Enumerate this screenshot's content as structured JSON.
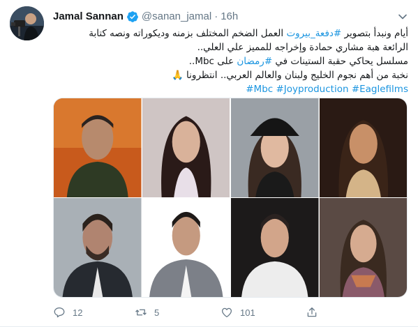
{
  "tweet": {
    "author_name": "Jamal Sannan",
    "verified": true,
    "handle": "@sanan_jamal",
    "separator": "·",
    "time": "16h",
    "lines": [
      {
        "parts": [
          {
            "t": "أيام ونبدأ بتصوير ",
            "link": false
          },
          {
            "t": "#دفعة_بيروت",
            "link": true
          },
          {
            "t": " العمل الضخم المختلف بزمنه وديكوراته ونصه كتابة",
            "link": false
          }
        ]
      },
      {
        "parts": [
          {
            "t": "الرائعة هبة مشاري حمادة وإخراجه للمميز علي العلي..",
            "link": false
          }
        ]
      },
      {
        "parts": [
          {
            "t": "مسلسل يحاكي حقبة الستينات في ",
            "link": false
          },
          {
            "t": "#رمضان",
            "link": true
          },
          {
            "t": " على Mbc..",
            "link": false
          }
        ]
      },
      {
        "parts": [
          {
            "t": "نخبة من أهم نجوم الخليج ولبنان والعالم العربي.. انتظرونا ",
            "link": false
          },
          {
            "t": "🙏",
            "link": false,
            "emoji": true
          }
        ]
      }
    ],
    "hashtags": "#Mbc #Joyproduction #Eaglefilms",
    "reply_count": "12",
    "retweet_count": "5",
    "like_count": "101"
  },
  "colors": {
    "link": "#1b95e0",
    "muted": "#657786",
    "verified": "#1da1f2"
  },
  "icons": {
    "verified": "verified-badge-icon",
    "caret": "chevron-down-icon",
    "reply": "reply-icon",
    "retweet": "retweet-icon",
    "like": "heart-icon",
    "share": "share-icon"
  },
  "media": {
    "photo_count": 8,
    "photos": [
      {
        "name": "portrait-man-dark-shirt"
      },
      {
        "name": "portrait-woman-long-dark-hair"
      },
      {
        "name": "portrait-man-beard-suit"
      },
      {
        "name": "portrait-man-grey-suit"
      },
      {
        "name": "portrait-woman-black-cap"
      },
      {
        "name": "portrait-woman-smiling"
      },
      {
        "name": "portrait-man-white-shirt"
      },
      {
        "name": "portrait-woman-scarf"
      }
    ]
  }
}
